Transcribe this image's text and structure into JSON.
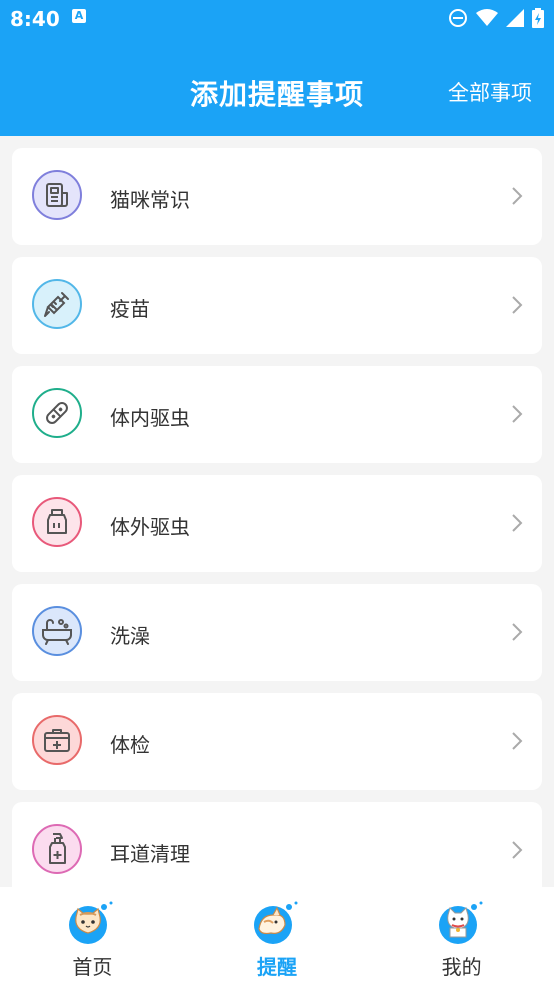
{
  "status_bar": {
    "time": "8:40",
    "notification_letter": "A"
  },
  "header": {
    "title": "添加提醒事项",
    "right_link": "全部事项"
  },
  "items": [
    {
      "label": "猫咪常识",
      "icon": "newspaper-icon",
      "tint": "#e4e4fb",
      "border": "#7f7fdc"
    },
    {
      "label": "疫苗",
      "icon": "syringe-icon",
      "tint": "#d8f1fb",
      "border": "#52b7e8"
    },
    {
      "label": "体内驱虫",
      "icon": "pill-icon",
      "tint": "#ffffff",
      "border": "#1fae8b"
    },
    {
      "label": "体外驱虫",
      "icon": "spray-bottle-icon",
      "tint": "#fde4ea",
      "border": "#e8597a"
    },
    {
      "label": "洗澡",
      "icon": "bathtub-icon",
      "tint": "#dbe7fb",
      "border": "#5a8fdf"
    },
    {
      "label": "体检",
      "icon": "medical-kit-icon",
      "tint": "#fdd8d8",
      "border": "#e86a6a"
    },
    {
      "label": "耳道清理",
      "icon": "ear-cleaner-bottle-icon",
      "tint": "#fbdcef",
      "border": "#dd6ab4"
    }
  ],
  "tabs": [
    {
      "label": "首页",
      "icon": "cat-face-icon",
      "active": false
    },
    {
      "label": "提醒",
      "icon": "cat-reminder-icon",
      "active": true
    },
    {
      "label": "我的",
      "icon": "lucky-cat-icon",
      "active": false
    }
  ],
  "colors": {
    "primary": "#1ba3f6",
    "background": "#f4f4f4"
  }
}
